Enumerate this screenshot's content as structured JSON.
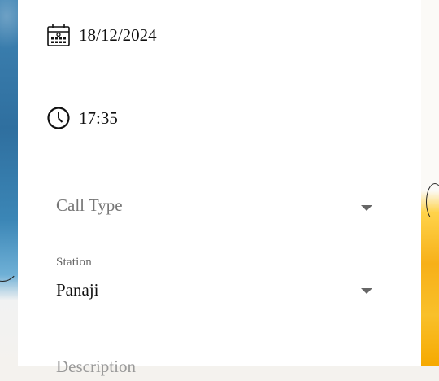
{
  "datetime": {
    "date": "18/12/2024",
    "date_icon": "calendar-icon",
    "time": "17:35",
    "time_icon": "clock-icon"
  },
  "form": {
    "call_type": {
      "placeholder": "Call Type",
      "icon": "dropdown-arrow-icon"
    },
    "station": {
      "label": "Station",
      "value": "Panaji",
      "icon": "dropdown-arrow-icon"
    },
    "description": {
      "label": "Description"
    }
  },
  "colors": {
    "left_art_blue": "#3f84b4",
    "right_art_yellow": "#f7b018",
    "panel": "#ffffff"
  }
}
